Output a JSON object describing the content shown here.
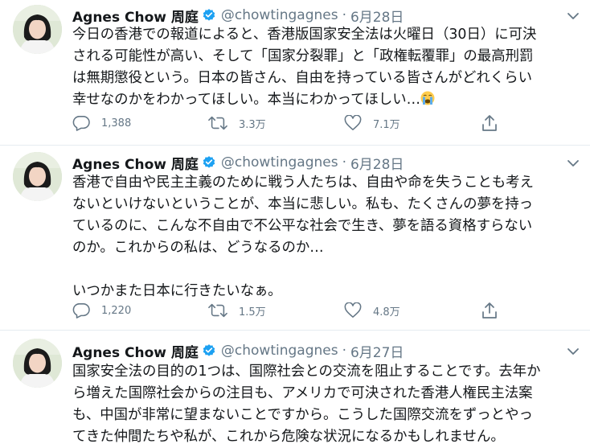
{
  "tweets": [
    {
      "name": "Agnes Chow 周庭",
      "handle": "@chowtingagnes",
      "date": "6月28日",
      "lines": [
        "今日の香港での報道によると、香港版国家安全法は火曜日（30日）に可決",
        "される可能性が高い、そして「国家分裂罪」と「政権転覆罪」の最高刑罰",
        "は無期懲役という。日本の皆さん、自由を持っている皆さんがどれくらい",
        "幸せなのかをわかってほしい。本当にわかってほしい…"
      ],
      "emoji": "crying-face-emoji",
      "replies": "1,388",
      "retweets": "3.3万",
      "likes": "7.1万"
    },
    {
      "name": "Agnes Chow 周庭",
      "handle": "@chowtingagnes",
      "date": "6月28日",
      "lines": [
        "香港で自由や民主主義のために戦う人たちは、自由や命を失うことも考え",
        "ないといけないということが、本当に悲しい。私も、たくさんの夢を持っ",
        "ているのに、こんな不自由で不公平な社会で生き、夢を語る資格すらない",
        "のか。これからの私は、どうなるのか…",
        "",
        "いつかまた日本に行きたいなぁ。"
      ],
      "replies": "1,220",
      "retweets": "1.5万",
      "likes": "4.8万"
    },
    {
      "name": "Agnes Chow 周庭",
      "handle": "@chowtingagnes",
      "date": "6月27日",
      "lines": [
        "国家安全法の目的の1つは、国際社会との交流を阻止することです。去年か",
        "ら増えた国際社会からの注目も、アメリカで可決された香港人権民主法案",
        "も、中国が非常に望まないことですから。こうした国際交流をずっとやっ",
        "てきた仲間たちや私が、これから危険な状況になるかもしれません。"
      ]
    }
  ],
  "colors": {
    "accent": "#1da1f2",
    "muted": "#657786",
    "text": "#14171a"
  }
}
